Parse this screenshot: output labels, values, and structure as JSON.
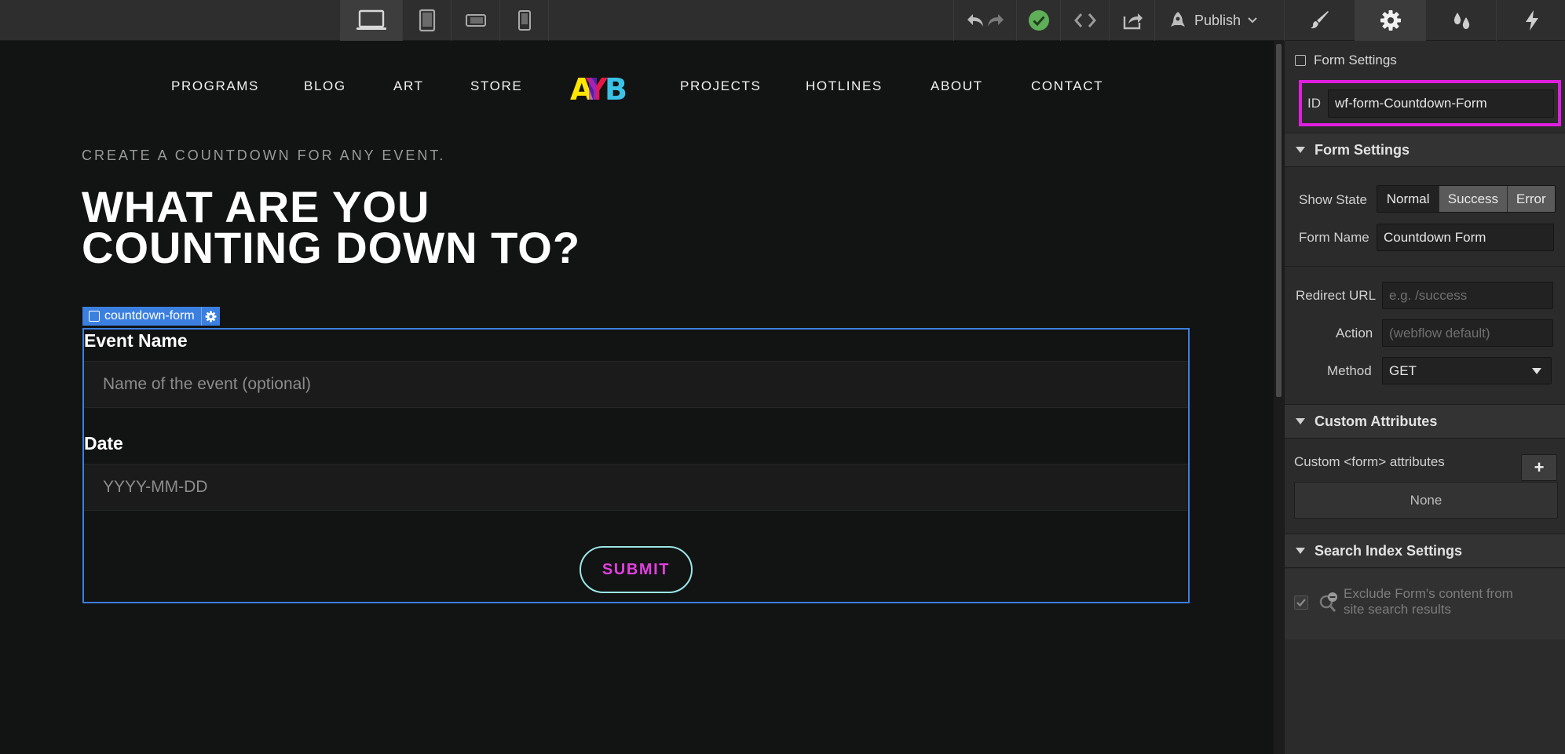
{
  "toolbar": {
    "devices": [
      "desktop-icon",
      "tablet-icon",
      "mobile-landscape-icon",
      "mobile-portrait-icon"
    ],
    "publish_label": "Publish",
    "panel_tabs": [
      "brush-icon",
      "gear-icon",
      "drops-icon",
      "lightning-icon"
    ]
  },
  "site": {
    "nav_left": [
      "PROGRAMS",
      "BLOG",
      "ART",
      "STORE"
    ],
    "nav_right": [
      "PROJECTS",
      "HOTLINES",
      "ABOUT",
      "CONTACT"
    ],
    "logo_text": "AYB",
    "eyebrow": "CREATE A COUNTDOWN FOR ANY EVENT.",
    "headline": "WHAT ARE YOU\nCOUNTING DOWN TO?",
    "form_tag": "countdown-form",
    "fields": [
      {
        "label": "Event Name",
        "placeholder": "Name of the event (optional)"
      },
      {
        "label": "Date",
        "placeholder": "YYYY-MM-DD"
      }
    ],
    "submit_label": "SUBMIT"
  },
  "panel": {
    "header_label": "Form Settings",
    "id_label": "ID",
    "id_value": "wf-form-Countdown-Form",
    "form_settings_title": "Form Settings",
    "show_state_label": "Show State",
    "states": [
      "Normal",
      "Success",
      "Error"
    ],
    "active_state": "Normal",
    "form_name_label": "Form Name",
    "form_name_value": "Countdown Form",
    "redirect_label": "Redirect URL",
    "redirect_placeholder": "e.g. /success",
    "action_label": "Action",
    "action_placeholder": "(webflow default)",
    "method_label": "Method",
    "method_value": "GET",
    "custom_attr_title": "Custom Attributes",
    "custom_attr_label": "Custom <form> attributes",
    "custom_attr_add": "+",
    "custom_attr_none": "None",
    "search_title": "Search Index Settings",
    "exclude_line1": "Exclude Form's content from",
    "exclude_line2": "site search results"
  },
  "colors": {
    "selection": "#3b80e0",
    "highlight": "#e01ee0",
    "submit_text": "#e33fe0",
    "submit_border": "#9be7e6",
    "status_ok": "#5fae58"
  }
}
